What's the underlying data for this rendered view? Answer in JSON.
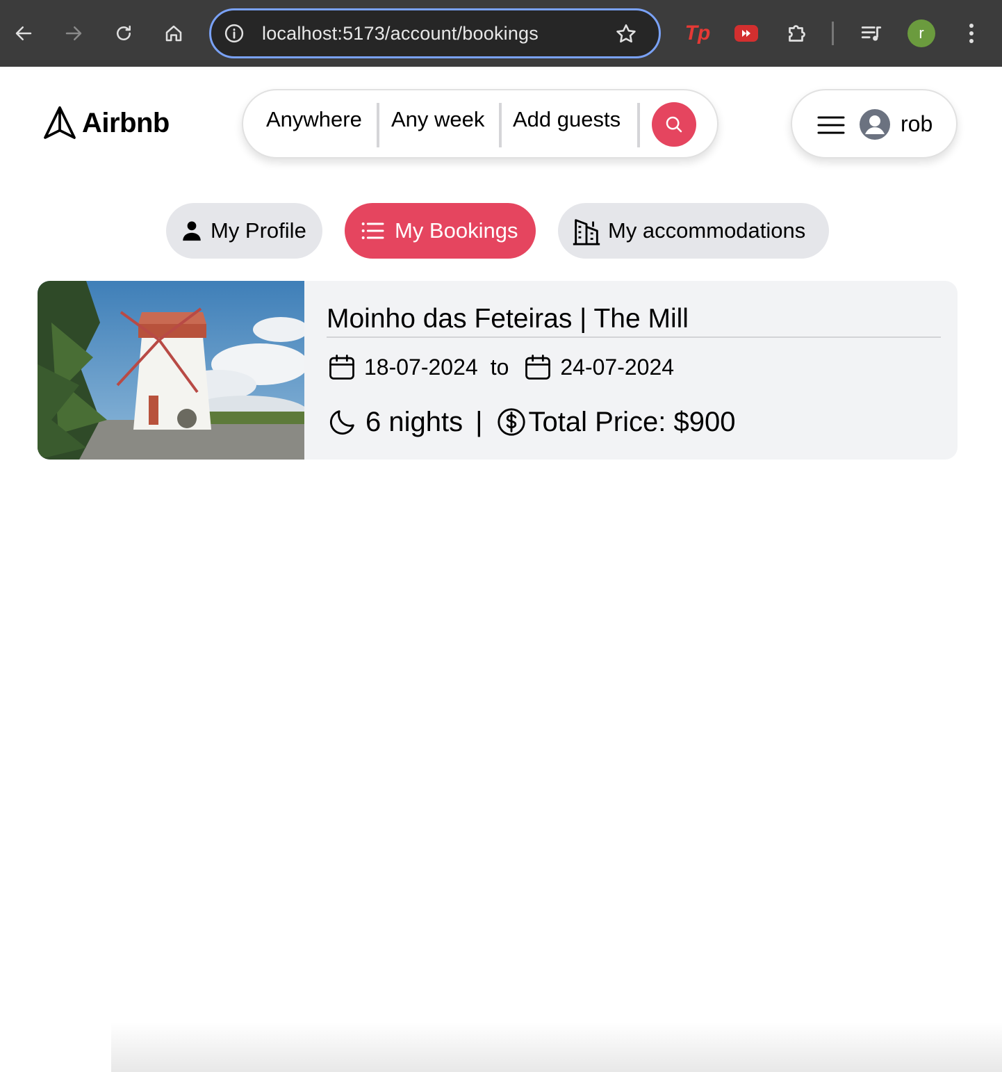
{
  "browser": {
    "url": "localhost:5173/account/bookings",
    "extensions": {
      "tp_label": "Tp"
    },
    "profile_initial": "r"
  },
  "header": {
    "logo_text": "Airbnb",
    "search": {
      "where": "Anywhere",
      "when": "Any week",
      "who": "Add guests"
    },
    "user_name": "rob"
  },
  "tabs": [
    {
      "label": "My Profile",
      "icon": "user-icon",
      "active": false
    },
    {
      "label": "My Bookings",
      "icon": "list-icon",
      "active": true
    },
    {
      "label": "My accommodations",
      "icon": "building-icon",
      "active": false
    }
  ],
  "bookings": [
    {
      "title": "Moinho das Feteiras | The Mill",
      "check_in": "18-07-2024",
      "to_label": "to",
      "check_out": "24-07-2024",
      "nights": "6 nights",
      "separator": "|",
      "total_price": "Total Price: $900"
    }
  ],
  "colors": {
    "brand": "#e5455f",
    "tab_bg": "#e5e6ea",
    "card_bg": "#f2f3f5",
    "chrome": "#3c3c3c",
    "omnibox_focus": "#7aa2f7"
  }
}
